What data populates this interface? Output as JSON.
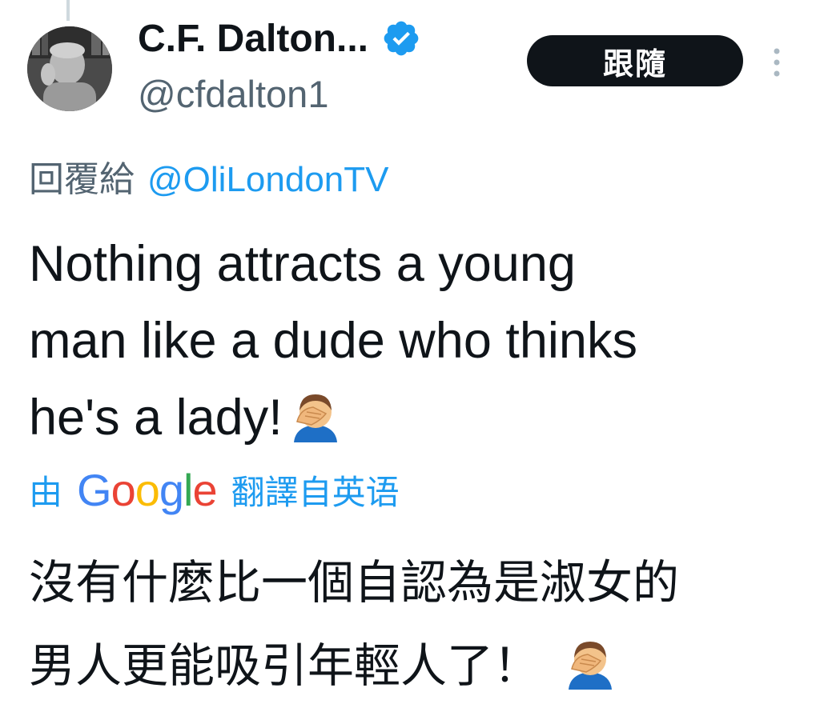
{
  "tweet": {
    "author": {
      "display_name": "C.F. Dalton...",
      "handle": "@cfdalton1",
      "verified_icon": "verified-badge-icon",
      "avatar_icon": "profile-photo"
    },
    "follow_label": "跟隨",
    "more_icon": "more-options-vertical-icon",
    "reply_prefix": "回覆給",
    "reply_mention": "@OliLondonTV",
    "text_line1": "Nothing attracts a young",
    "text_line2": "man like a dude who thinks",
    "text_line3": "he's a lady!",
    "emoji": "face-palm-emoji",
    "translation": {
      "by_label": "由",
      "provider": "Google",
      "provider_letters": [
        "G",
        "o",
        "o",
        "g",
        "l",
        "e"
      ],
      "provider_colors": [
        "#4285f4",
        "#ea4335",
        "#fbbc05",
        "#4285f4",
        "#34a853",
        "#ea4335"
      ],
      "action_label": "翻譯自英语",
      "text_line1": "沒有什麼比一個自認為是淑女的",
      "text_line2": "男人更能吸引年輕人了！"
    }
  },
  "colors": {
    "text_primary": "#0f1419",
    "text_secondary": "#536471",
    "accent_blue": "#1d9bf0",
    "button_bg": "#0f1419"
  }
}
